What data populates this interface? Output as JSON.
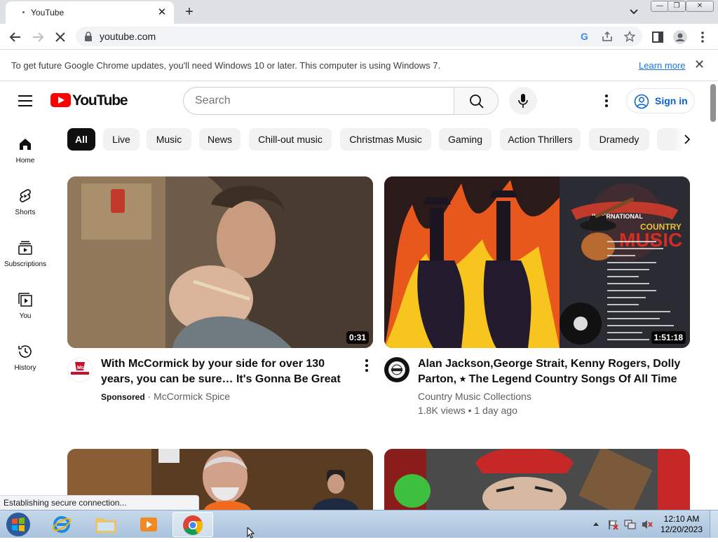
{
  "browser": {
    "tab_title": "YouTube",
    "url": "youtube.com",
    "infobar_message": "To get future Google Chrome updates, you'll need Windows 10 or later. This computer is using Windows 7.",
    "infobar_link": "Learn more",
    "status_text": "Establishing secure connection..."
  },
  "youtube": {
    "logo_text": "YouTube",
    "search_placeholder": "Search",
    "signin_label": "Sign in",
    "sidebar": [
      {
        "label": "Home",
        "icon": "home-icon"
      },
      {
        "label": "Shorts",
        "icon": "shorts-icon"
      },
      {
        "label": "Subscriptions",
        "icon": "subscriptions-icon"
      },
      {
        "label": "You",
        "icon": "you-icon"
      },
      {
        "label": "History",
        "icon": "history-icon"
      }
    ],
    "chips": [
      "All",
      "Live",
      "Music",
      "News",
      "Chill-out music",
      "Christmas Music",
      "Gaming",
      "Action Thrillers",
      "Dramedy"
    ],
    "videos": [
      {
        "title": "With McCormick by your side for over 130 years, you can be sure… It's Gonna Be Great",
        "duration": "0:31",
        "sponsored": "Sponsored",
        "channel": "McCormick Spice"
      },
      {
        "title": "Alan Jackson,George Strait, Kenny Rogers, Dolly Parton, ⭒ The Legend Country Songs Of All Time",
        "duration": "1:51:18",
        "channel": "Country Music Collections",
        "stats": "1.8K views • 1 day ago",
        "thumb_badge_top": "INTERNATIONAL",
        "thumb_badge_mid": "COUNTRY",
        "thumb_badge_big": "MUSIC"
      }
    ]
  },
  "taskbar": {
    "time": "12:10 AM",
    "date": "12/20/2023"
  },
  "colors": {
    "yt_red": "#ff0000",
    "link_blue": "#065fd4",
    "chrome_blue": "#1a73e8"
  }
}
